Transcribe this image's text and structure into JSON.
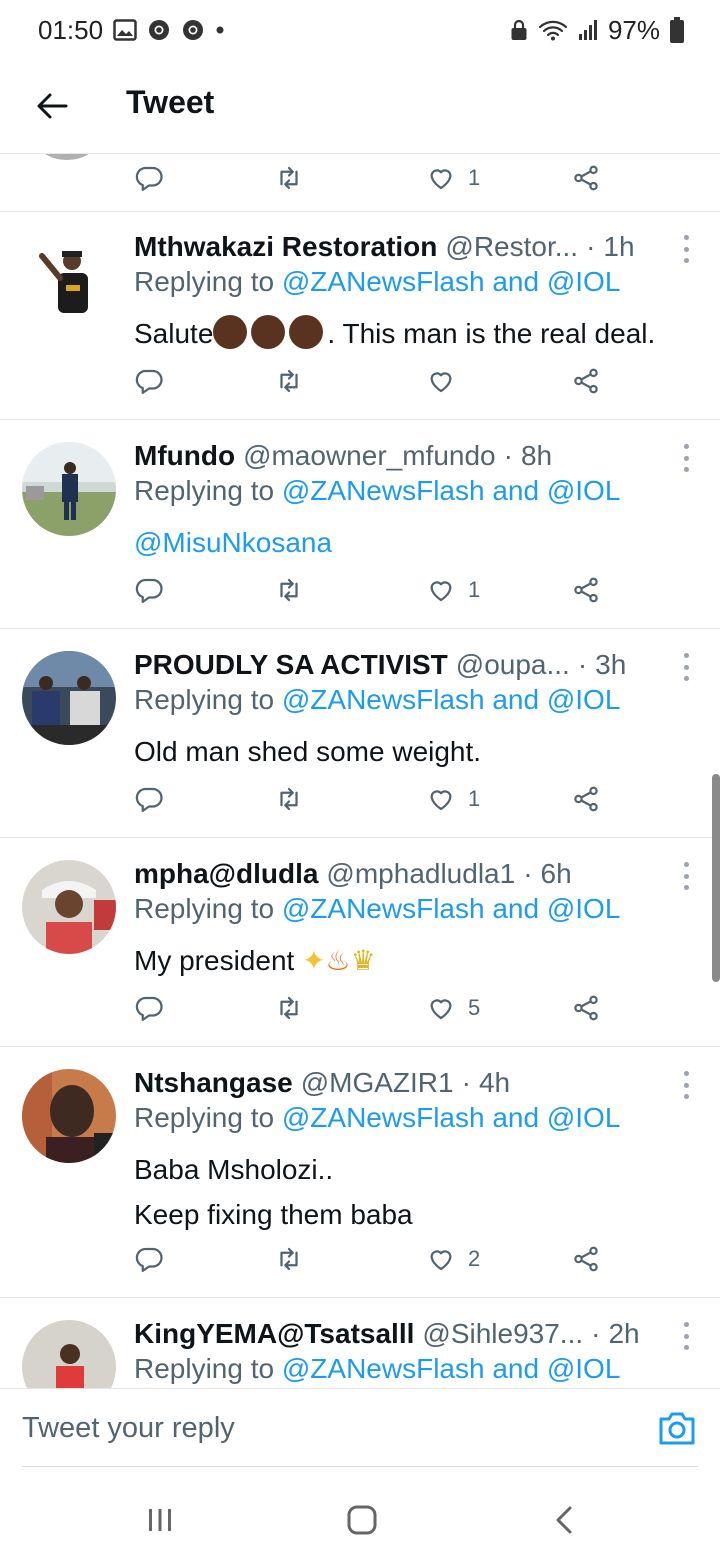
{
  "status_bar": {
    "time": "01:50",
    "battery": "97%"
  },
  "header": {
    "title": "Tweet"
  },
  "partial_tweet": {
    "like_count": "1"
  },
  "tweets": [
    {
      "name": "Mthwakazi Restoration",
      "handle": "@Restor...",
      "time": "1h",
      "replying_prefix": "Replying to",
      "replying_to_1": "@ZANewsFlash",
      "replying_and": "and",
      "replying_to_2": "@IOL",
      "body_prefix": "Salute",
      "body_suffix": ". This man is the real deal.",
      "like_count": ""
    },
    {
      "name": "Mfundo",
      "handle": "@maowner_mfundo",
      "time": "8h",
      "replying_prefix": "Replying to",
      "replying_to_1": "@ZANewsFlash",
      "replying_and": "and",
      "replying_to_2": "@IOL",
      "body": "@MisuNkosana",
      "like_count": "1"
    },
    {
      "name": "PROUDLY SA ACTIVIST",
      "handle": "@oupa...",
      "time": "3h",
      "replying_prefix": "Replying to",
      "replying_to_1": "@ZANewsFlash",
      "replying_and": "and",
      "replying_to_2": "@IOL",
      "body": "Old man shed some weight.",
      "like_count": "1"
    },
    {
      "name": "mpha@dludla",
      "handle": "@mphadludla1",
      "time": "6h",
      "replying_prefix": "Replying to",
      "replying_to_1": "@ZANewsFlash",
      "replying_and": "and",
      "replying_to_2": "@IOL",
      "body": "My president",
      "like_count": "5"
    },
    {
      "name": "Ntshangase",
      "handle": "@MGAZIR1",
      "time": "4h",
      "replying_prefix": "Replying to",
      "replying_to_1": "@ZANewsFlash",
      "replying_and": "and",
      "replying_to_2": "@IOL",
      "body_line1": "Baba Msholozi..",
      "body_line2": "Keep fixing them baba",
      "like_count": "2"
    },
    {
      "name": "KingYEMA@Tsatsalll",
      "handle": "@Sihle937...",
      "time": "2h",
      "replying_prefix": "Replying to",
      "replying_to_1": "@ZANewsFlash",
      "replying_and": "and",
      "replying_to_2": "@IOL"
    }
  ],
  "reply_bar": {
    "placeholder": "Tweet your reply"
  },
  "icons": {
    "back": "arrow-left-icon",
    "reply": "reply-icon",
    "retweet": "retweet-icon",
    "like": "heart-icon",
    "share": "share-icon",
    "more": "more-vertical-icon",
    "camera": "camera-icon"
  },
  "colors": {
    "link": "#1d9bf0",
    "secondary": "#536471",
    "primary_text": "#0f1419",
    "divider": "#e6e6e6"
  }
}
